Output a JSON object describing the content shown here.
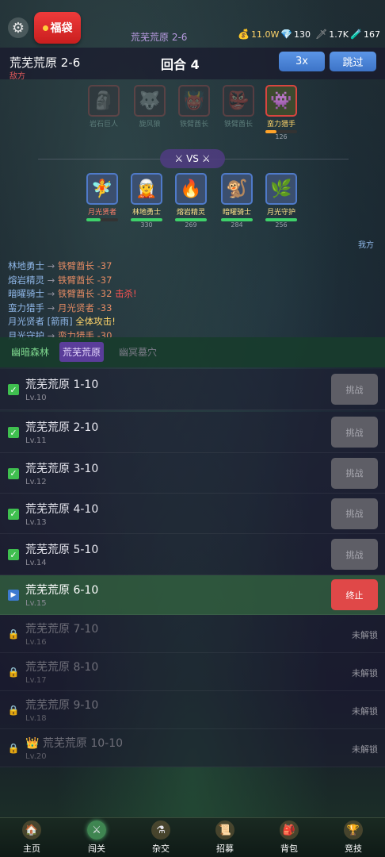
{
  "header": {
    "lucky_bag_label": "福袋",
    "stage_name": "荒芜荒原 2-6",
    "resources": [
      {
        "icon": "money-bag-icon",
        "glyph": "💰",
        "value": "11.0W"
      },
      {
        "icon": "diamond-icon",
        "glyph": "💎",
        "value": "130"
      },
      {
        "icon": "sword-icon",
        "glyph": "🗡",
        "value": "1.7K"
      },
      {
        "icon": "potion-icon",
        "glyph": "🧪",
        "value": "167"
      }
    ]
  },
  "battle": {
    "title": "荒芜荒原 2-6",
    "enemy_label": "敌方",
    "round_label": "回合 4",
    "speed_label": "3x",
    "skip_label": "跳过",
    "vs_label": "VS",
    "me_label": "我方",
    "enemies": [
      {
        "name": "岩石巨人",
        "hp": "",
        "hp_fraction": 0,
        "dead": true,
        "glyph": "🗿"
      },
      {
        "name": "旋风狼",
        "hp": "",
        "hp_fraction": 0,
        "dead": true,
        "glyph": "🐺"
      },
      {
        "name": "铁臂酋长",
        "hp": "",
        "hp_fraction": 0,
        "dead": true,
        "glyph": "👹"
      },
      {
        "name": "铁臂酋长",
        "hp": "",
        "hp_fraction": 0,
        "dead": true,
        "glyph": "👺"
      },
      {
        "name": "蛮力猎手",
        "hp": "126",
        "hp_fraction": 0.35,
        "dead": false,
        "glyph": "👾"
      }
    ],
    "allies": [
      {
        "name": "月光贤者",
        "hp": "",
        "hp_fraction": 0.45,
        "glyph": "🧚"
      },
      {
        "name": "林地勇士",
        "hp": "330",
        "hp_fraction": 1.0,
        "glyph": "🧝"
      },
      {
        "name": "熔岩精灵",
        "hp": "269",
        "hp_fraction": 1.0,
        "glyph": "🔥"
      },
      {
        "name": "暗曜骑士",
        "hp": "284",
        "hp_fraction": 1.0,
        "glyph": "🐒"
      },
      {
        "name": "月光守护",
        "hp": "256",
        "hp_fraction": 1.0,
        "glyph": "🌿"
      }
    ],
    "log": [
      {
        "actor": "林地勇士",
        "arrow": "→",
        "target": "铁臂酋长",
        "dmg": "-37",
        "extra": ""
      },
      {
        "actor": "熔岩精灵",
        "arrow": "→",
        "target": "铁臂酋长",
        "dmg": "-37",
        "extra": ""
      },
      {
        "actor": "暗曜骑士",
        "arrow": "→",
        "target": "铁臂酋长",
        "dmg": "-32",
        "extra": "击杀!"
      },
      {
        "actor": "蛮力猎手",
        "arrow": "→",
        "target": "月光贤者",
        "dmg": "-33",
        "extra": ""
      },
      {
        "actor": "月光贤者",
        "arrow": "[箭雨]",
        "target": "",
        "dmg": "",
        "extra": "全体攻击!"
      },
      {
        "actor": "月光守护",
        "arrow": "→",
        "target": "蛮力猎手",
        "dmg": "-30",
        "extra": ""
      }
    ]
  },
  "areas": {
    "tabs": [
      "幽暗森林",
      "荒芜荒原",
      "幽冥墓穴"
    ],
    "active": 1
  },
  "levels": [
    {
      "name": "荒芜荒原 1-10",
      "lv": "Lv.10",
      "state": "done",
      "action": "挑战"
    },
    {
      "name": "荒芜荒原 2-10",
      "lv": "Lv.11",
      "state": "done",
      "action": "挑战"
    },
    {
      "name": "荒芜荒原 3-10",
      "lv": "Lv.12",
      "state": "done",
      "action": "挑战"
    },
    {
      "name": "荒芜荒原 4-10",
      "lv": "Lv.13",
      "state": "done",
      "action": "挑战"
    },
    {
      "name": "荒芜荒原 5-10",
      "lv": "Lv.14",
      "state": "done",
      "action": "挑战"
    },
    {
      "name": "荒芜荒原 6-10",
      "lv": "Lv.15",
      "state": "active",
      "action": "终止"
    },
    {
      "name": "荒芜荒原 7-10",
      "lv": "Lv.16",
      "state": "locked",
      "action": "未解锁"
    },
    {
      "name": "荒芜荒原 8-10",
      "lv": "Lv.17",
      "state": "locked",
      "action": "未解锁"
    },
    {
      "name": "荒芜荒原 9-10",
      "lv": "Lv.18",
      "state": "locked",
      "action": "未解锁"
    },
    {
      "name": "荒芜荒原 10-10",
      "lv": "Lv.20",
      "state": "locked-boss",
      "action": "未解锁"
    }
  ],
  "nav": [
    {
      "label": "主页",
      "icon": "home-icon",
      "glyph": "🏠",
      "active": false
    },
    {
      "label": "闯关",
      "icon": "crossed-swords-icon",
      "glyph": "⚔",
      "active": true
    },
    {
      "label": "杂交",
      "icon": "flask-icon",
      "glyph": "⚗",
      "active": false
    },
    {
      "label": "招募",
      "icon": "scroll-icon",
      "glyph": "📜",
      "active": false
    },
    {
      "label": "背包",
      "icon": "backpack-icon",
      "glyph": "🎒",
      "active": false
    },
    {
      "label": "竞技",
      "icon": "trophy-icon",
      "glyph": "🏆",
      "active": false
    }
  ],
  "colors": {
    "accent_blue": "#4a86d8",
    "stop_red": "#e04848",
    "active_row": "#305a3e",
    "damage_orange": "#e38a63",
    "kill_red": "#ff5252",
    "skill_yellow": "#ffd56a"
  }
}
